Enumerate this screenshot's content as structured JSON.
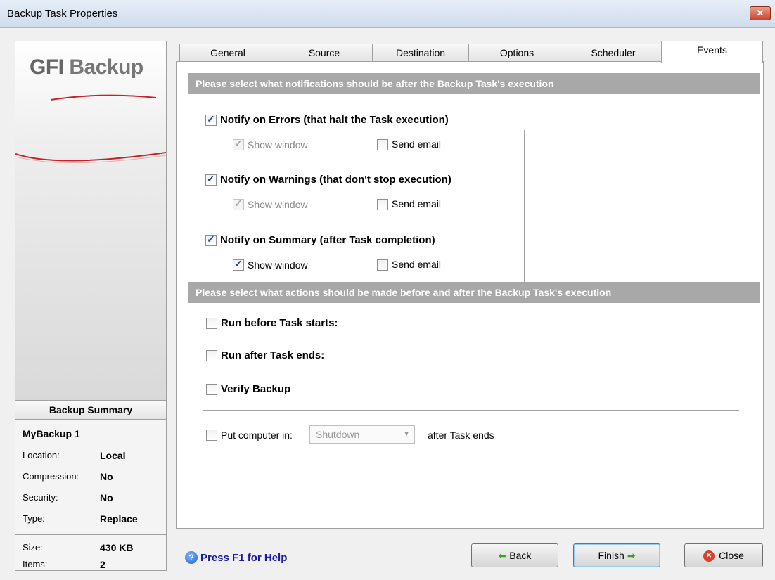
{
  "window": {
    "title": "Backup Task Properties",
    "close_symbol": "✕"
  },
  "logo": {
    "gfi": "GFI",
    "backup": "Backup"
  },
  "summary": {
    "header": "Backup Summary",
    "name": "MyBackup 1",
    "rows": [
      {
        "label": "Location:",
        "value": "Local"
      },
      {
        "label": "Compression:",
        "value": "No"
      },
      {
        "label": "Security:",
        "value": "No"
      },
      {
        "label": "Type:",
        "value": "Replace"
      },
      {
        "label": "Size:",
        "value": "430 KB"
      },
      {
        "label": "Items:",
        "value": "2"
      }
    ]
  },
  "tabs": [
    {
      "label": "General",
      "active": false
    },
    {
      "label": "Source",
      "active": false
    },
    {
      "label": "Destination",
      "active": false
    },
    {
      "label": "Options",
      "active": false
    },
    {
      "label": "Scheduler",
      "active": false
    },
    {
      "label": "Events",
      "active": true
    }
  ],
  "notifications": {
    "header": "Please select what notifications should be after the Backup Task's execution",
    "items": [
      {
        "label": "Notify on Errors  (that halt the Task execution)",
        "checked": true,
        "show_window": {
          "label": "Show window",
          "checked": true,
          "disabled": true
        },
        "send_email": {
          "label": "Send email",
          "checked": false
        }
      },
      {
        "label": "Notify on Warnings  (that don't stop execution)",
        "checked": true,
        "show_window": {
          "label": "Show window",
          "checked": true,
          "disabled": true
        },
        "send_email": {
          "label": "Send email",
          "checked": false
        }
      },
      {
        "label": "Notify on Summary  (after Task completion)",
        "checked": true,
        "show_window": {
          "label": "Show window",
          "checked": true,
          "disabled": false
        },
        "send_email": {
          "label": "Send email",
          "checked": false
        }
      }
    ]
  },
  "actions": {
    "header": "Please select what actions should be made before and after the Backup Task's execution",
    "run_before": {
      "label": "Run before Task starts:",
      "checked": false
    },
    "run_after": {
      "label": "Run after Task ends:",
      "checked": false
    },
    "verify": {
      "label": "Verify Backup",
      "checked": false
    },
    "put_computer": {
      "label": "Put computer in:",
      "checked": false,
      "select_value": "Shutdown",
      "suffix": "after Task ends"
    }
  },
  "footer": {
    "help_icon": "?",
    "help_text": "Press F1 for Help",
    "back_label": "Back",
    "finish_label": "Finish",
    "close_label": "Close",
    "back_arrow": "⬅",
    "finish_arrow": "➡",
    "close_mark": "✕"
  }
}
